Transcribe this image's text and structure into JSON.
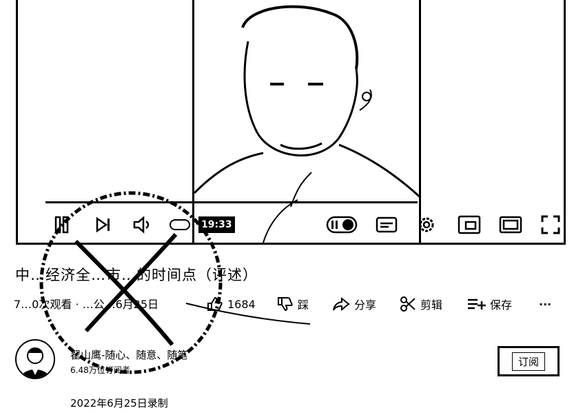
{
  "player": {
    "time": "19:33"
  },
  "video": {
    "title": "中…经济全…市…的时间点（评述）",
    "meta": "7…0次观看 · …公…6月25日"
  },
  "actions": {
    "like_count": "1684",
    "dislike_label": "踩",
    "share_label": "分享",
    "clip_label": "剪辑",
    "save_label": "保存",
    "more_label": "···"
  },
  "channel": {
    "name": "翟山鹰-随心、随意、随笔",
    "subscribers": "6.48万位订阅者",
    "subscribe_label": "订阅"
  },
  "description": {
    "recorded": "2022年6月25日录制"
  },
  "icons": [
    "pause-icon",
    "next-icon",
    "volume-icon",
    "miniplayer-toggle-icon",
    "subtitles-icon",
    "gear-icon",
    "miniplayer-icon",
    "theater-icon",
    "fullscreen-icon",
    "like-icon",
    "dislike-icon",
    "share-icon",
    "scissors-icon",
    "playlist-add-icon",
    "more-icon"
  ]
}
